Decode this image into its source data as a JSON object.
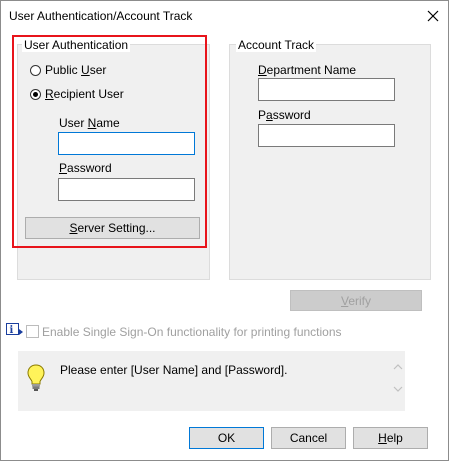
{
  "dialog": {
    "title": "User Authentication/Account Track",
    "close_icon": "close-icon"
  },
  "user_auth": {
    "group_label": "User Authentication",
    "public_user_label": "Public User",
    "public_user_selected": false,
    "recipient_user_label": "Recipient User",
    "recipient_user_selected": true,
    "user_name_label": "User Name",
    "user_name_value": "",
    "password_label": "Password",
    "password_value": "",
    "server_setting_label": "Server Setting..."
  },
  "account_track": {
    "group_label": "Account Track",
    "department_name_label": "Department Name",
    "department_name_value": "",
    "password_label": "Password",
    "password_value": ""
  },
  "verify_label": "Verify",
  "sso": {
    "label": "Enable Single Sign-On functionality for printing functions",
    "checked": false,
    "enabled": false,
    "icon": "info-icon"
  },
  "message": {
    "icon": "lightbulb-icon",
    "text": "Please enter [User Name] and [Password]."
  },
  "buttons": {
    "ok_label": "OK",
    "cancel_label": "Cancel",
    "help_label": "Help"
  },
  "colors": {
    "highlight": "#e8141b",
    "focus_border": "#0078d7",
    "dialog_bg": "#f0f0f0"
  }
}
